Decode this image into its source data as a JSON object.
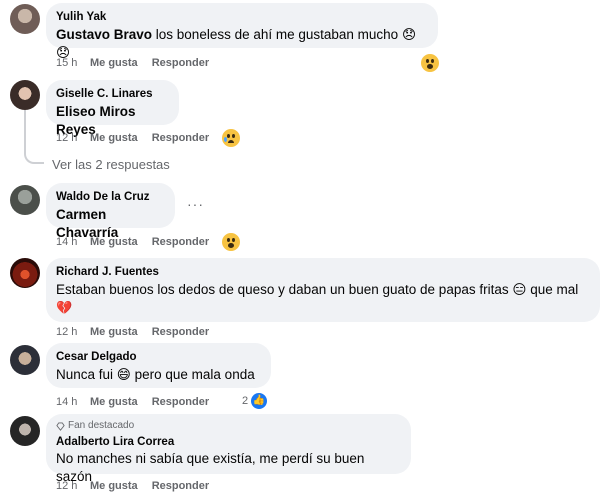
{
  "comments": [
    {
      "author": "Yulih Yak",
      "mention": "Gustavo Bravo",
      "text": " los boneless de ahí me gustaban mucho ",
      "emoji": "😞😞",
      "time": "15 h",
      "like_label": "Me gusta",
      "reply_label": "Responder",
      "reaction": "wow"
    },
    {
      "author": "Giselle C. Linares",
      "mention": "Eliseo Miros Reyes",
      "text": "",
      "time": "12 h",
      "like_label": "Me gusta",
      "reply_label": "Responder",
      "reaction": "sad"
    },
    {
      "author": "Waldo De la Cruz",
      "mention": "Carmen Chavarría",
      "text": "",
      "time": "14 h",
      "like_label": "Me gusta",
      "reply_label": "Responder",
      "reaction": "wow",
      "more": "···"
    },
    {
      "author": "Richard J. Fuentes",
      "text_line1": "Estaban buenos los dedos de queso y daban un buen guato de papas fritas",
      "text_tail": " que mal",
      "emoji": "😑",
      "heart": "💔",
      "time": "12 h",
      "like_label": "Me gusta",
      "reply_label": "Responder"
    },
    {
      "author": "Cesar Delgado",
      "text_pre": "Nunca fui ",
      "emoji": "😄",
      "text_post": " pero que mala onda",
      "time": "14 h",
      "like_label": "Me gusta",
      "reply_label": "Responder",
      "like_count": "2"
    },
    {
      "badge": "Fan destacado",
      "author": "Adalberto Lira Correa",
      "text": "No manches ni sabía que existía, me perdí su buen sazón",
      "time": "12 h",
      "like_label": "Me gusta",
      "reply_label": "Responder"
    }
  ],
  "see_replies": "Ver las 2 respuestas",
  "colors": {
    "bubble": "#f0f2f5",
    "meta": "#65676b",
    "like_blue": "#1877f2"
  }
}
